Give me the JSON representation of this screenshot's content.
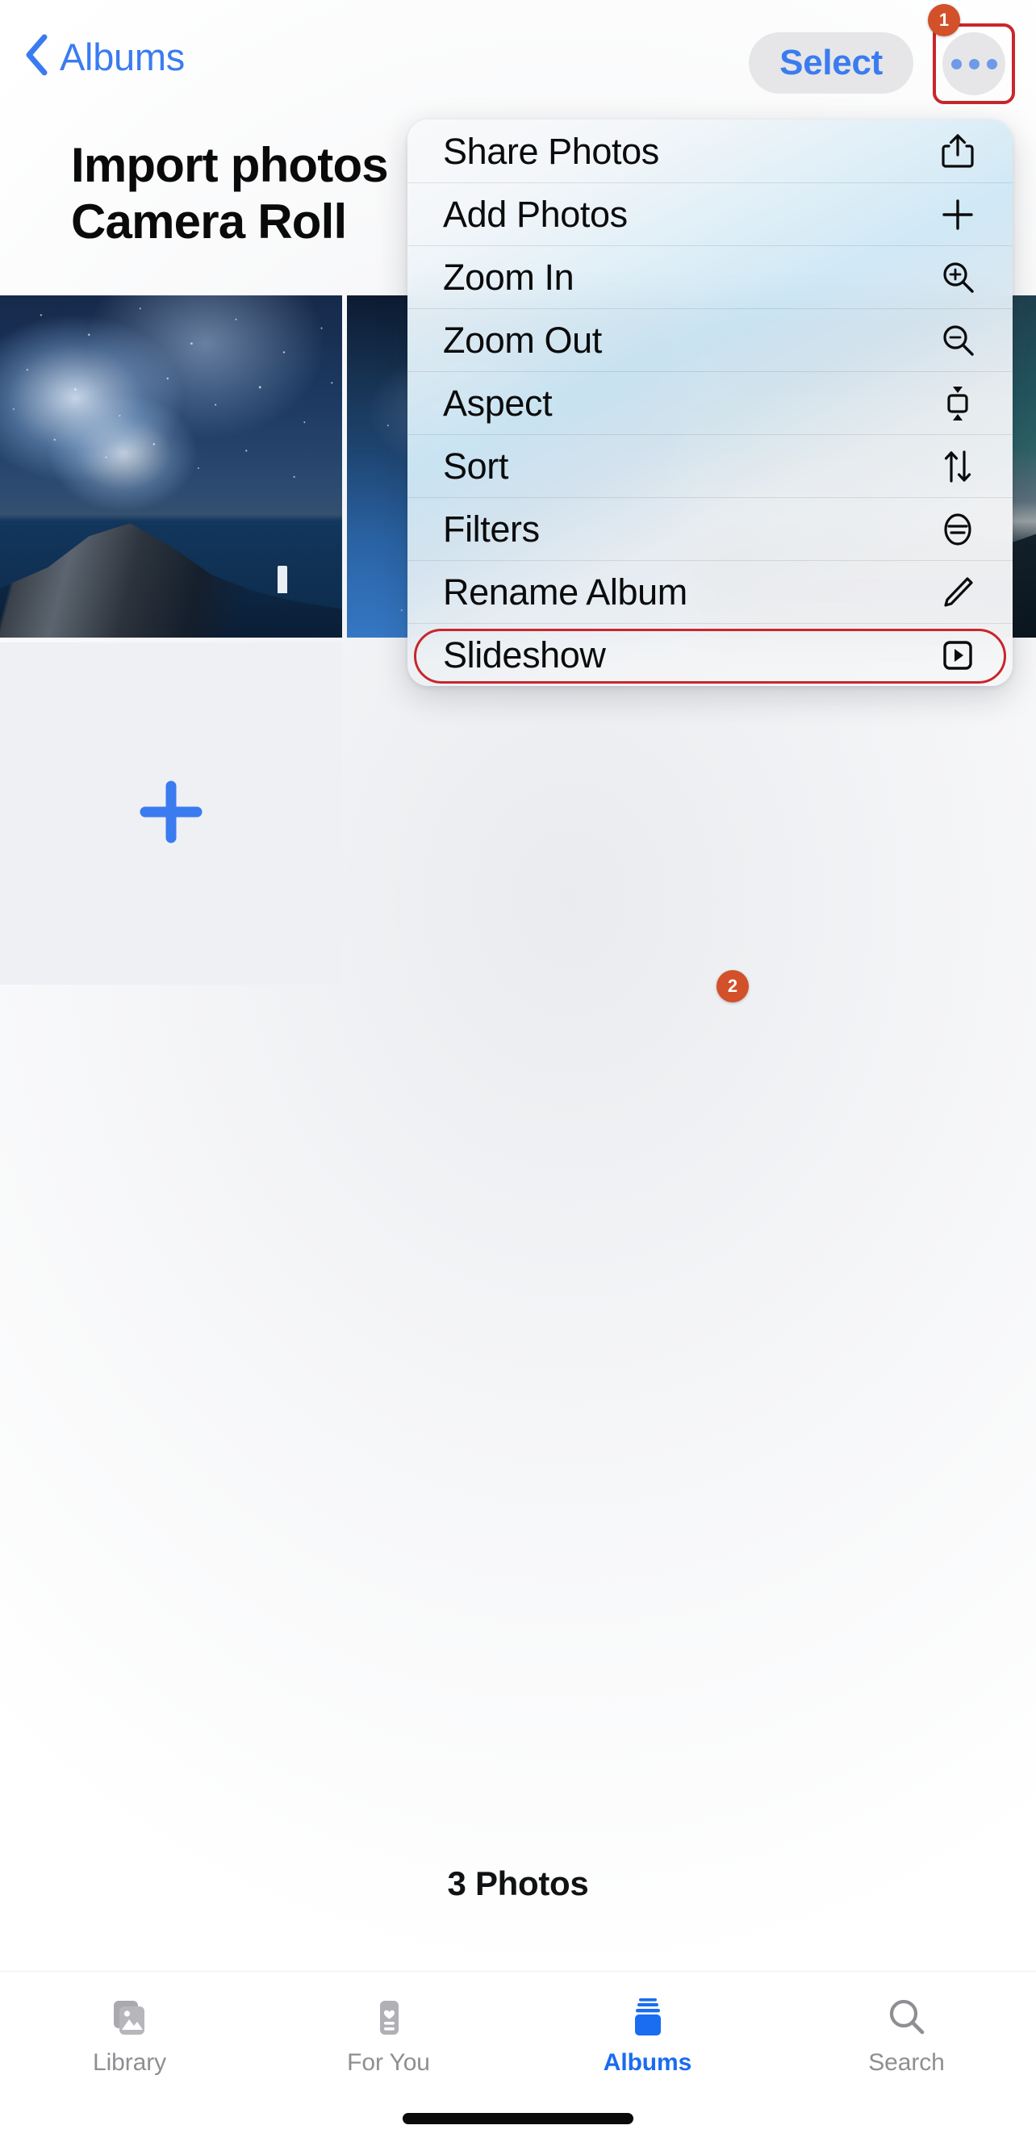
{
  "navbar": {
    "back_label": "Albums",
    "back_icon": "chevron-left-icon",
    "select_label": "Select",
    "more_icon": "ellipsis-icon"
  },
  "annotations": {
    "badge_one": "1",
    "badge_two": "2",
    "highlight_color": "#c9262c",
    "badge_color": "#d2502a"
  },
  "album": {
    "title": "Import photos\nCamera Roll",
    "photo_count": "3 Photos"
  },
  "grid": {
    "add_icon": "plus-icon",
    "thumbs": [
      {
        "name": "photo-thumbnail-starry-sea",
        "style": "starry-sea"
      },
      {
        "name": "photo-thumbnail-starry-gradient",
        "style": "starry-gradient"
      },
      {
        "name": "photo-thumbnail-teal-mountain",
        "style": "teal-mountain"
      }
    ]
  },
  "context_menu": {
    "items": [
      {
        "label": "Share Photos",
        "icon": "share-icon"
      },
      {
        "label": "Add Photos",
        "icon": "plus-icon"
      },
      {
        "label": "Zoom In",
        "icon": "zoom-in-icon"
      },
      {
        "label": "Zoom Out",
        "icon": "zoom-out-icon"
      },
      {
        "label": "Aspect",
        "icon": "aspect-icon"
      },
      {
        "label": "Sort",
        "icon": "sort-arrows-icon"
      },
      {
        "label": "Filters",
        "icon": "filters-icon"
      },
      {
        "label": "Rename Album",
        "icon": "pencil-icon"
      },
      {
        "label": "Slideshow",
        "icon": "play-rect-icon"
      }
    ]
  },
  "tabbar": {
    "items": [
      {
        "label": "Library",
        "icon": "photo-stack-icon",
        "active": false
      },
      {
        "label": "For You",
        "icon": "heart-card-icon",
        "active": false
      },
      {
        "label": "Albums",
        "icon": "albums-icon",
        "active": true
      },
      {
        "label": "Search",
        "icon": "search-icon",
        "active": false
      }
    ]
  },
  "colors": {
    "accent_blue": "#1a6cf0",
    "link_blue": "#3b7bf0",
    "inactive_gray": "#8e8e93"
  }
}
